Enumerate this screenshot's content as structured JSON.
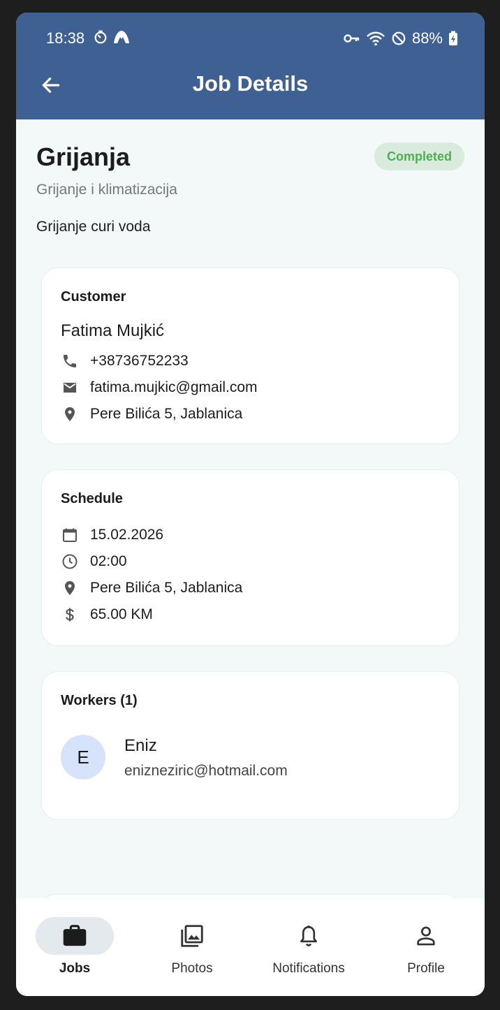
{
  "status_bar": {
    "time": "18:38",
    "battery": "88%"
  },
  "app_bar": {
    "title": "Job Details"
  },
  "job": {
    "title": "Grijanja",
    "status": "Completed",
    "category": "Grijanje i klimatizacija",
    "description": "Grijanje curi voda"
  },
  "customer_card": {
    "heading": "Customer",
    "name": "Fatima Mujkić",
    "phone": "+38736752233",
    "email": "fatima.mujkic@gmail.com",
    "address": "Pere Bilića 5, Jablanica"
  },
  "schedule_card": {
    "heading": "Schedule",
    "date": "15.02.2026",
    "time": "02:00",
    "address": "Pere Bilića 5, Jablanica",
    "price": "65.00 KM"
  },
  "workers_card": {
    "heading": "Workers (1)",
    "workers": [
      {
        "initial": "E",
        "name": "Eniz",
        "email": "enizneziric@hotmail.com"
      }
    ]
  },
  "bottom_nav": {
    "items": [
      {
        "label": "Jobs",
        "icon": "briefcase-icon",
        "active": true
      },
      {
        "label": "Photos",
        "icon": "photo-library-icon",
        "active": false
      },
      {
        "label": "Notifications",
        "icon": "bell-icon",
        "active": false
      },
      {
        "label": "Profile",
        "icon": "person-icon",
        "active": false
      }
    ]
  },
  "colors": {
    "app_bar": "#3f6093",
    "background": "#f3f8f8",
    "status_completed_text": "#4caf50",
    "status_completed_bg": "#d9ebdc",
    "avatar_bg": "#d6e3fb"
  }
}
